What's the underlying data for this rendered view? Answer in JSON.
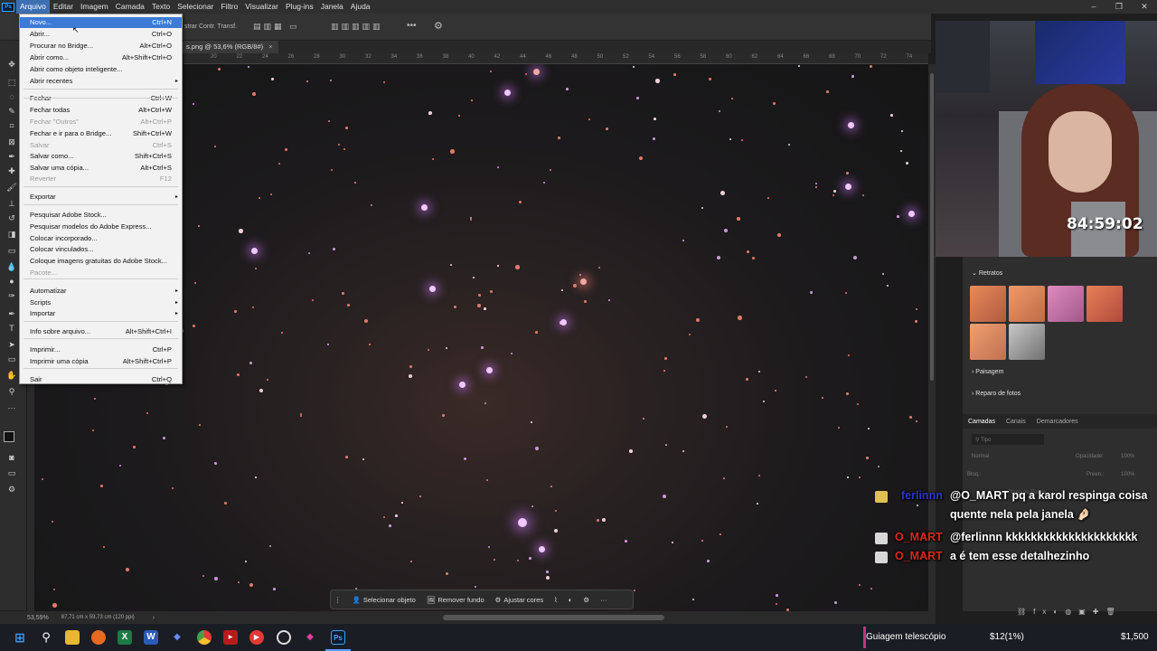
{
  "menubar": {
    "items": [
      "Arquivo",
      "Editar",
      "Imagem",
      "Camada",
      "Texto",
      "Selecionar",
      "Filtro",
      "Visualizar",
      "Plug-ins",
      "Janela",
      "Ajuda"
    ],
    "active": "Arquivo"
  },
  "optionsbar": {
    "transform_label": "strar Contr. Transf."
  },
  "document_tab": {
    "title": "s.png @ 53,6% (RGB/8#)",
    "close": "×"
  },
  "ruler": {
    "ticks": [
      "20",
      "22",
      "24",
      "26",
      "28",
      "30",
      "32",
      "34",
      "36",
      "38",
      "40",
      "42",
      "44",
      "46",
      "48",
      "50",
      "52",
      "54",
      "56",
      "58",
      "60",
      "62",
      "64",
      "66",
      "68",
      "70",
      "72",
      "74"
    ]
  },
  "file_menu": {
    "items": [
      {
        "label": "Novo...",
        "shortcut": "Ctrl+N",
        "state": "highlight"
      },
      {
        "label": "Abrir...",
        "shortcut": "Ctrl+O"
      },
      {
        "label": "Procurar no Bridge...",
        "shortcut": "Alt+Ctrl+O"
      },
      {
        "label": "Abrir como...",
        "shortcut": "Alt+Shift+Ctrl+O"
      },
      {
        "label": "Abrir como objeto inteligente...",
        "shortcut": ""
      },
      {
        "label": "Abrir recentes",
        "shortcut": "",
        "submenu": true
      },
      {
        "label": "Fechar",
        "shortcut": "Ctrl+W"
      },
      {
        "label": "Fechar todas",
        "shortcut": "Alt+Ctrl+W"
      },
      {
        "label": "Fechar \"Outros\"",
        "shortcut": "Alt+Ctrl+P",
        "state": "disabled"
      },
      {
        "label": "Fechar e ir para o Bridge...",
        "shortcut": "Shift+Ctrl+W"
      },
      {
        "label": "Salvar",
        "shortcut": "Ctrl+S",
        "state": "disabled"
      },
      {
        "label": "Salvar como...",
        "shortcut": "Shift+Ctrl+S"
      },
      {
        "label": "Salvar uma cópia...",
        "shortcut": "Alt+Ctrl+S"
      },
      {
        "label": "Reverter",
        "shortcut": "F12",
        "state": "disabled"
      },
      {
        "label": "Exportar",
        "shortcut": "",
        "submenu": true
      },
      {
        "label": "Pesquisar Adobe Stock...",
        "shortcut": ""
      },
      {
        "label": "Pesquisar modelos do Adobe Express...",
        "shortcut": ""
      },
      {
        "label": "Colocar incorporado...",
        "shortcut": ""
      },
      {
        "label": "Colocar vinculados...",
        "shortcut": ""
      },
      {
        "label": "Coloque imagens gratuitas do Adobe Stock...",
        "shortcut": ""
      },
      {
        "label": "Pacote...",
        "shortcut": "",
        "state": "disabled"
      },
      {
        "label": "Automatizar",
        "shortcut": "",
        "submenu": true
      },
      {
        "label": "Scripts",
        "shortcut": "",
        "submenu": true
      },
      {
        "label": "Importar",
        "shortcut": "",
        "submenu": true
      },
      {
        "label": "Info sobre arquivo...",
        "shortcut": "Alt+Shift+Ctrl+I"
      },
      {
        "label": "Imprimir...",
        "shortcut": "Ctrl+P"
      },
      {
        "label": "Imprimir uma cópia",
        "shortcut": "Alt+Shift+Ctrl+P"
      },
      {
        "label": "Sair",
        "shortcut": "Ctrl+Q"
      }
    ]
  },
  "context_bar": {
    "select_subject": "Selecionar objeto",
    "remove_bg": "Remover fundo",
    "adjust_colors": "Ajustar cores",
    "more": "···"
  },
  "status": {
    "zoom": "53,59%",
    "doc_size": "87,71 cm x 59,73 cm (120 ppi)",
    "arrow": "›"
  },
  "stream": {
    "timer": "84:59:02",
    "chat": [
      {
        "user": "ferlinnn",
        "user_color": "#2b35c8",
        "message": "@O_MART pq a karol respinga coisa quente nela pela janela 🤌🏻"
      },
      {
        "user": "O_MART",
        "user_color": "#d9281e",
        "message": "@ferlinnn kkkkkkkkkkkkkkkkkkkkk"
      },
      {
        "user": "O_MART",
        "user_color": "#d9281e",
        "message": "a é tem esse detalhezinho"
      }
    ]
  },
  "neural_panel": {
    "section1": "Retratos",
    "section2": "Paisagem",
    "section3": "Reparo de fotos"
  },
  "layers_panel": {
    "tabs": [
      "Camadas",
      "Canais",
      "Demarcadores"
    ],
    "search_placeholder": "Tipo",
    "blend_mode": "Normal",
    "opacity_label": "Opacidade:",
    "opacity_value": "100%",
    "lock_label": "Bloq.:",
    "fill_label": "Preen.:",
    "fill_value": "100%",
    "layer_name": "Plano de Fundo"
  },
  "taskbar": {
    "ticker_label": "Guiagem telescópio",
    "ticker_value": "$12(1%)",
    "ticker_goal": "$1,500"
  },
  "colors": {
    "menu_highlight": "#3d7ad6",
    "accent_ps": "#31a8ff",
    "ticker_bar": "#c8307a"
  }
}
